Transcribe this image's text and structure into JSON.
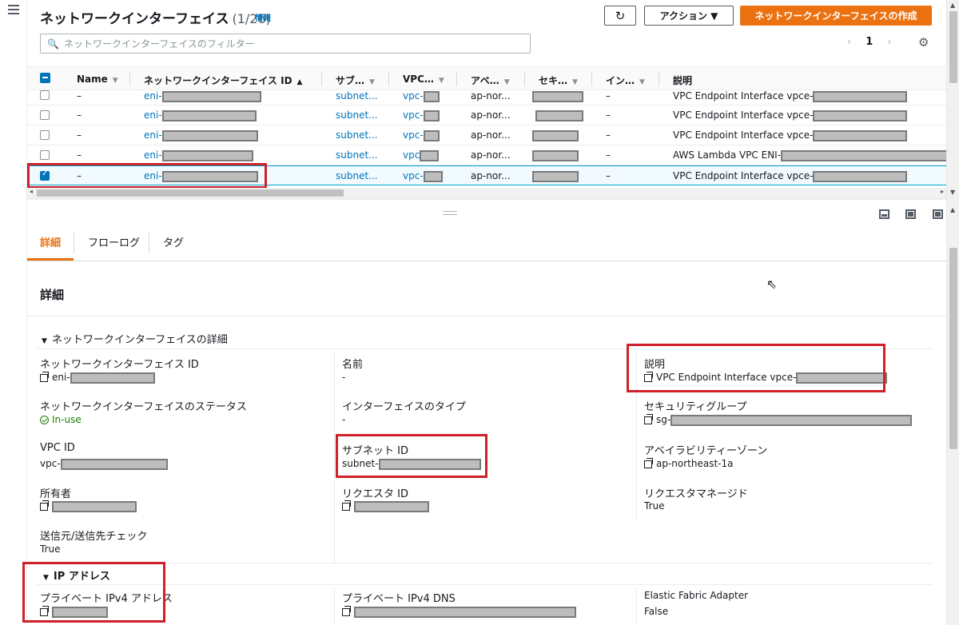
{
  "header": {
    "title": "ネットワークインターフェイス",
    "count": "(1/26)",
    "info": "情報",
    "refresh_icon": "refresh-icon",
    "action_label": "アクション ▼",
    "create_label": "ネットワークインターフェイスの作成"
  },
  "filter": {
    "placeholder": "ネットワークインターフェイスのフィルター"
  },
  "pager": {
    "prev": "‹",
    "page": "1",
    "next": "›"
  },
  "table": {
    "columns": [
      "Name",
      "ネットワークインターフェイス ID",
      "サブ…",
      "VPC…",
      "アベ…",
      "セキ…",
      "イン…",
      "説明"
    ],
    "rows": [
      {
        "name": "–",
        "eni": "eni-",
        "subnet": "subnet...",
        "vpc": "vpc-",
        "az": "ap-nor...",
        "ins": "–",
        "desc": "VPC Endpoint Interface vpce-",
        "checked": false
      },
      {
        "name": "–",
        "eni": "eni-",
        "subnet": "subnet...",
        "vpc": "vpc-",
        "az": "ap-nor...",
        "ins": "–",
        "desc": "VPC Endpoint Interface vpce-",
        "checked": false
      },
      {
        "name": "–",
        "eni": "eni-",
        "subnet": "subnet...",
        "vpc": "vpc-",
        "az": "ap-nor...",
        "ins": "–",
        "desc": "VPC Endpoint Interface vpce-",
        "checked": false
      },
      {
        "name": "–",
        "eni": "eni-",
        "subnet": "subnet...",
        "vpc": "vpc",
        "az": "ap-nor...",
        "ins": "–",
        "desc": "AWS Lambda VPC ENI-",
        "checked": false
      },
      {
        "name": "–",
        "eni": "eni-",
        "subnet": "subnet...",
        "vpc": "vpc-",
        "az": "ap-nor...",
        "ins": "–",
        "desc": "VPC Endpoint Interface vpce-",
        "checked": true
      }
    ]
  },
  "tabs": [
    "詳細",
    "フローログ",
    "タグ"
  ],
  "details": {
    "title": "詳細",
    "section1": "ネットワークインターフェイスの詳細",
    "eni_id_label": "ネットワークインターフェイス ID",
    "eni_id_value": "eni-",
    "name_label": "名前",
    "name_value": "-",
    "desc_label": "説明",
    "desc_value": "VPC Endpoint Interface vpce-",
    "status_label": "ネットワークインターフェイスのステータス",
    "status_value": "In-use",
    "iftype_label": "インターフェイスのタイプ",
    "iftype_value": "-",
    "sg_label": "セキュリティグループ",
    "sg_value": "sg-",
    "vpc_label": "VPC ID",
    "vpc_value": "vpc-",
    "subnet_label": "サブネット ID",
    "subnet_value": "subnet-",
    "az_label": "アベイラビリティーゾーン",
    "az_value": "ap-northeast-1a",
    "owner_label": "所有者",
    "requester_label": "リクエスタ ID",
    "requester_managed_label": "リクエスタマネージド",
    "requester_managed_value": "True",
    "srcdst_label": "送信元/送信先チェック",
    "srcdst_value": "True",
    "section2": "IP アドレス",
    "private_ip_label": "プライベート IPv4 アドレス",
    "private_dns_label": "プライベート IPv4 DNS",
    "efa_label": "Elastic Fabric Adapter",
    "efa_value": "False"
  },
  "colors": {
    "accent": "#ec7211",
    "link": "#0073bb",
    "highlight": "#d0202a",
    "ok": "#1d8102"
  }
}
